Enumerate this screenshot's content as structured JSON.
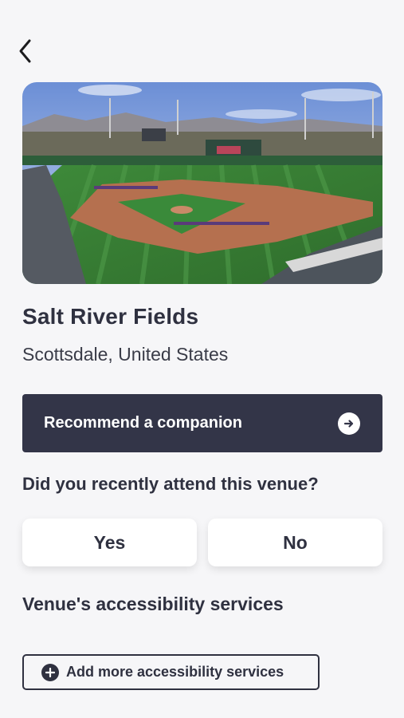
{
  "venue": {
    "name": "Salt River Fields",
    "location": "Scottsdale, United States"
  },
  "recommend": {
    "label": "Recommend a companion",
    "icon": "arrow-right-circle-icon"
  },
  "attendance": {
    "question": "Did you recently attend this venue?",
    "yes_label": "Yes",
    "no_label": "No"
  },
  "accessibility": {
    "title": "Venue's accessibility services",
    "add_label": "Add more accessibility services",
    "add_icon": "plus-circle-icon"
  },
  "navigation": {
    "back_icon": "chevron-left-icon"
  },
  "colors": {
    "background": "#f6f6f8",
    "primary_dark": "#333548",
    "text": "#2f3140",
    "card": "#ffffff"
  }
}
